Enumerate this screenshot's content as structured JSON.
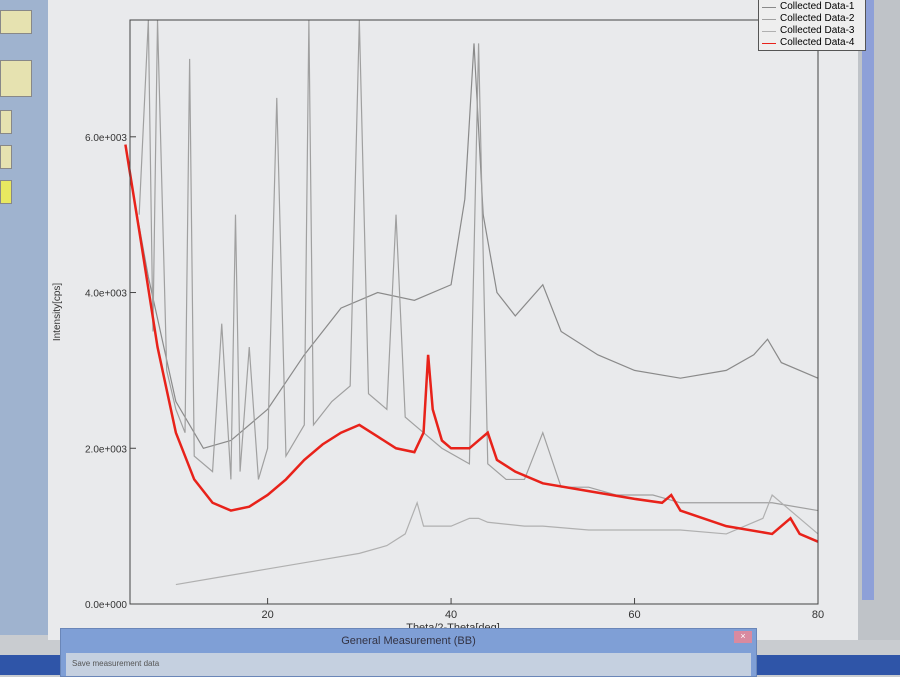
{
  "chart_data": {
    "type": "line",
    "xlabel": "Theta/2-Theta[deg]",
    "ylabel": "Intensity[cps]",
    "xlim": [
      5,
      80
    ],
    "ylim": [
      0,
      7500
    ],
    "xticks": [
      20,
      40,
      60,
      80
    ],
    "yticks": [
      0,
      2000,
      4000,
      6000
    ],
    "ytick_labels": [
      "0.0e+000",
      "2.0e+003",
      "4.0e+003",
      "6.0e+003"
    ],
    "grid": false,
    "legend_position": "top-right",
    "series": [
      {
        "name": "Collected Data-1",
        "color": "#8a8a8a",
        "x": [
          5,
          7,
          10,
          13,
          16,
          20,
          24,
          28,
          32,
          36,
          40,
          41.5,
          42.5,
          43.5,
          45,
          47,
          50,
          52,
          56,
          60,
          65,
          70,
          73,
          74.5,
          76,
          80
        ],
        "y": [
          5500,
          4200,
          2600,
          2000,
          2100,
          2500,
          3200,
          3800,
          4000,
          3900,
          4100,
          5200,
          7200,
          5000,
          4000,
          3700,
          4100,
          3500,
          3200,
          3000,
          2900,
          3000,
          3200,
          3400,
          3100,
          2900
        ]
      },
      {
        "name": "Collected Data-2",
        "color": "#a0a0a0",
        "x": [
          6,
          7,
          7.5,
          8,
          9,
          10,
          11,
          11.5,
          12,
          14,
          15,
          16,
          16.5,
          17,
          18,
          19,
          20,
          21,
          22,
          24,
          24.5,
          25,
          27,
          29,
          30,
          31,
          33,
          34,
          35,
          36,
          37,
          39,
          42,
          43,
          44,
          46,
          48,
          50,
          52,
          55,
          58,
          62,
          65,
          68,
          72,
          75,
          80
        ],
        "y": [
          5000,
          7500,
          3500,
          7500,
          3000,
          2500,
          2200,
          7000,
          1900,
          1700,
          3600,
          1600,
          5000,
          1700,
          3300,
          1600,
          2000,
          6500,
          1900,
          2300,
          7500,
          2300,
          2600,
          2800,
          7500,
          2700,
          2500,
          5000,
          2400,
          2300,
          2200,
          2000,
          1800,
          7200,
          1800,
          1600,
          1600,
          2200,
          1500,
          1500,
          1400,
          1400,
          1300,
          1300,
          1300,
          1300,
          1200
        ]
      },
      {
        "name": "Collected Data-3",
        "color": "#b0b0b0",
        "x": [
          10,
          15,
          20,
          25,
          30,
          33,
          35,
          36.3,
          37,
          40,
          42,
          43,
          44,
          48,
          50,
          55,
          60,
          65,
          70,
          74,
          75,
          80
        ],
        "y": [
          250,
          350,
          450,
          550,
          650,
          750,
          900,
          1300,
          1000,
          1000,
          1100,
          1100,
          1050,
          1000,
          1000,
          950,
          950,
          950,
          900,
          1100,
          1400,
          900
        ]
      },
      {
        "name": "Collected Data-4",
        "color": "#e8221a",
        "x": [
          4.5,
          6,
          8,
          10,
          12,
          14,
          16,
          18,
          20,
          22,
          24,
          26,
          28,
          30,
          32,
          34,
          36,
          37,
          37.5,
          38,
          39,
          40,
          42,
          43,
          44,
          45,
          47,
          50,
          55,
          60,
          63,
          64,
          65,
          70,
          75,
          77,
          78,
          80
        ],
        "y": [
          5900,
          4800,
          3300,
          2200,
          1600,
          1300,
          1200,
          1250,
          1400,
          1600,
          1850,
          2050,
          2200,
          2300,
          2150,
          2000,
          1950,
          2200,
          3200,
          2500,
          2100,
          2000,
          2000,
          2100,
          2200,
          1850,
          1700,
          1550,
          1450,
          1350,
          1300,
          1400,
          1200,
          1000,
          900,
          1100,
          900,
          800
        ]
      }
    ]
  },
  "dialog": {
    "title": "General Measurement (BB)",
    "body": "Save measurement data",
    "close": "×"
  }
}
